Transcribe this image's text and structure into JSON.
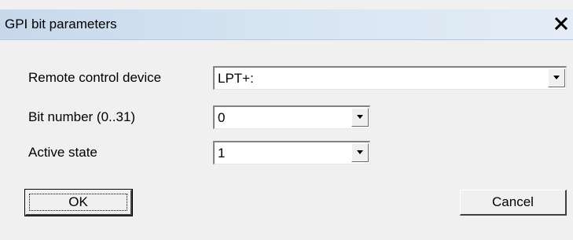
{
  "window": {
    "title": "GPI bit parameters",
    "close_icon": "close-icon"
  },
  "form": {
    "remote_device": {
      "label": "Remote control device",
      "value": "LPT+:"
    },
    "bit_number": {
      "label": "Bit number (0..31)",
      "value": "0"
    },
    "active_state": {
      "label": "Active state",
      "value": "1"
    }
  },
  "buttons": {
    "ok_label": "OK",
    "cancel_label": "Cancel"
  }
}
